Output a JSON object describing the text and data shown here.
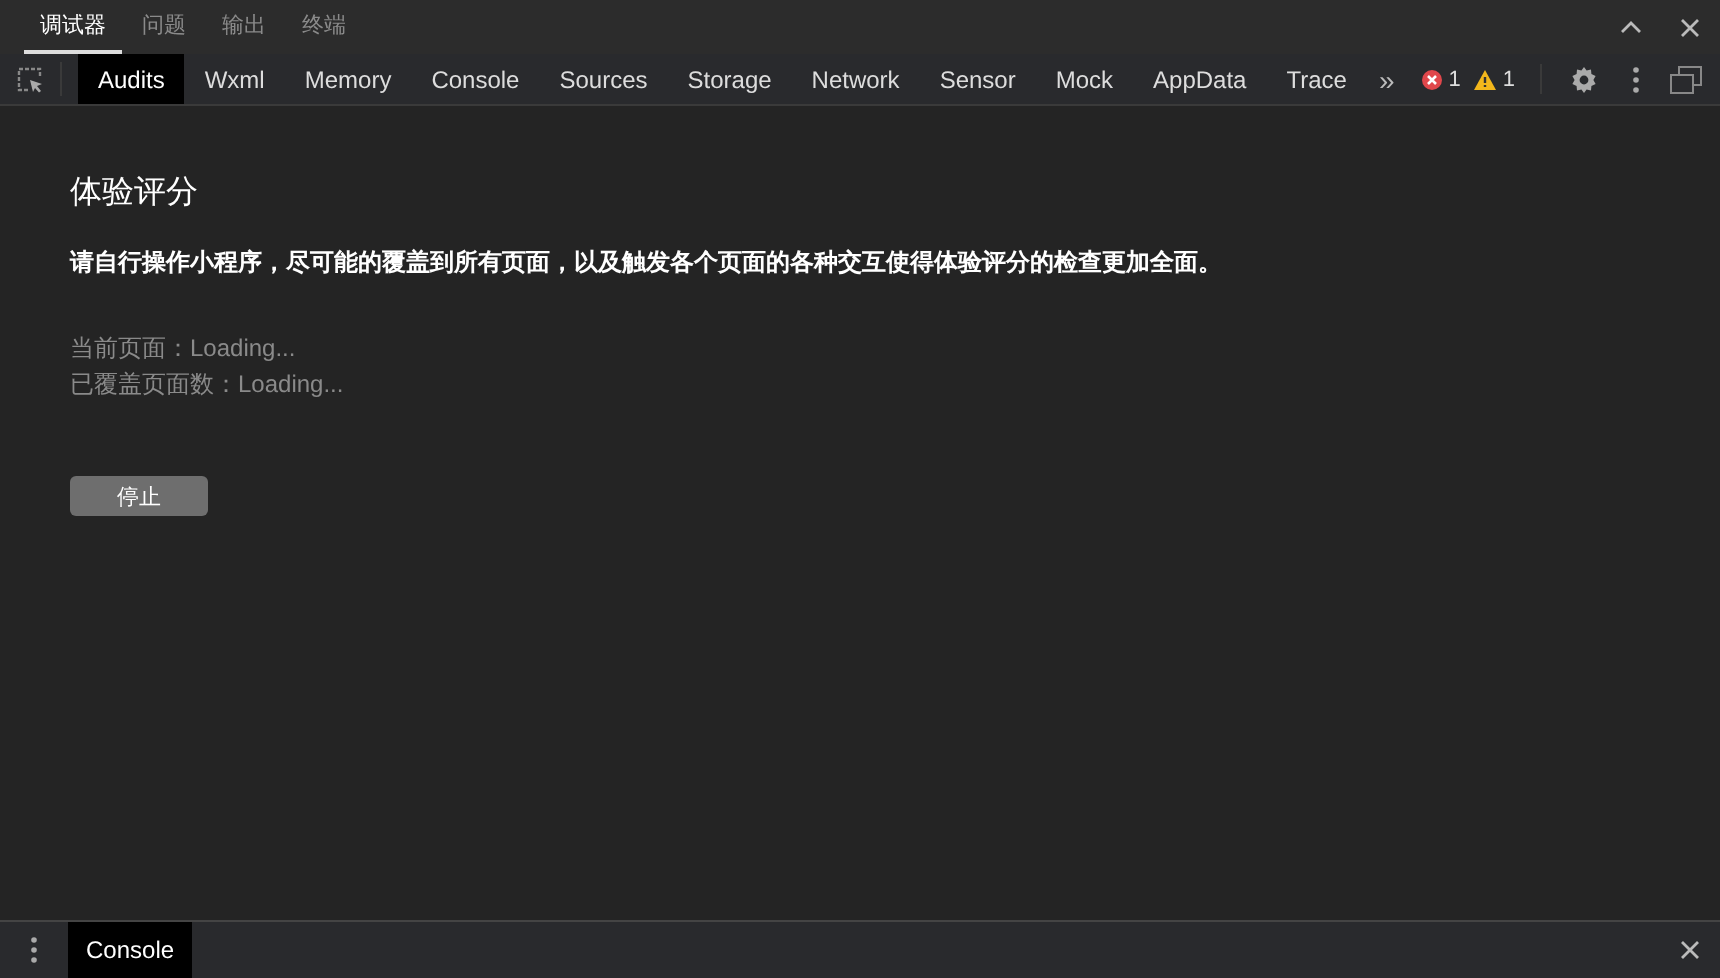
{
  "top_tabs": [
    {
      "label": "调试器",
      "selected": true
    },
    {
      "label": "问题",
      "selected": false
    },
    {
      "label": "输出",
      "selected": false
    },
    {
      "label": "终端",
      "selected": false
    }
  ],
  "panel_tabs": [
    {
      "label": "Audits",
      "selected": true
    },
    {
      "label": "Wxml",
      "selected": false
    },
    {
      "label": "Memory",
      "selected": false
    },
    {
      "label": "Console",
      "selected": false
    },
    {
      "label": "Sources",
      "selected": false
    },
    {
      "label": "Storage",
      "selected": false
    },
    {
      "label": "Network",
      "selected": false
    },
    {
      "label": "Sensor",
      "selected": false
    },
    {
      "label": "Mock",
      "selected": false
    },
    {
      "label": "AppData",
      "selected": false
    },
    {
      "label": "Trace",
      "selected": false
    }
  ],
  "more_tabs": "»",
  "error_count": "1",
  "warning_count": "1",
  "audit": {
    "title": "体验评分",
    "description": "请自行操作小程序，尽可能的覆盖到所有页面，以及触发各个页面的各种交互使得体验评分的检查更加全面。",
    "current_page": "当前页面：Loading...",
    "covered_pages": "已覆盖页面数：Loading...",
    "stop_button": "停止"
  },
  "drawer": {
    "tabs": [
      {
        "label": "Console",
        "selected": true
      }
    ]
  }
}
